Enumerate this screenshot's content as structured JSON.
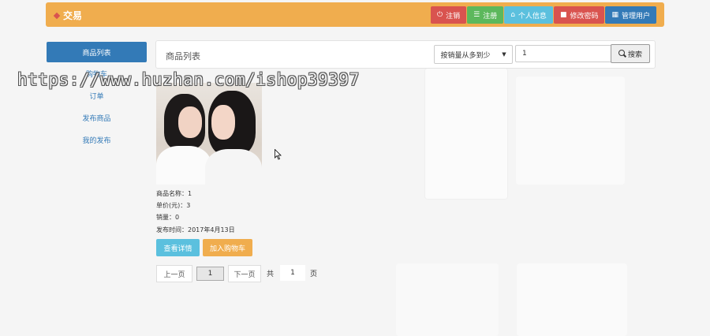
{
  "navbar": {
    "brand": "交易",
    "buttons": [
      {
        "label": "注销",
        "icon": "power-icon",
        "color": "#d9534f"
      },
      {
        "label": "注册",
        "icon": "list-icon",
        "color": "#5cb85c"
      },
      {
        "label": "个人信息",
        "icon": "home-icon",
        "color": "#5bc0de"
      },
      {
        "label": "修改密码",
        "icon": "lock-icon",
        "color": "#d9534f"
      },
      {
        "label": "管理用户",
        "icon": "grid-icon",
        "color": "#337ab7"
      }
    ]
  },
  "sidebar": {
    "items": [
      {
        "label": "商品列表"
      },
      {
        "label": "购物车"
      },
      {
        "label": "订单"
      },
      {
        "label": "发布商品"
      },
      {
        "label": "我的发布"
      }
    ]
  },
  "main": {
    "title": "商品列表",
    "sort": {
      "selected": "按销量从多到少"
    },
    "search": {
      "value": "1",
      "button_label": "搜索"
    }
  },
  "product": {
    "name_label": "商品名称：",
    "name": "1",
    "price_label": "单价(元)：",
    "price": "3",
    "sales_label": "销量：",
    "sales": "0",
    "date_label": "发布时间：",
    "date": "2017年4月13日",
    "detail_button": "查看详情",
    "cart_button": "加入购物车"
  },
  "pager": {
    "prev": "上一页",
    "current": "1",
    "next": "下一页",
    "total_prefix": "共",
    "total": "1",
    "total_suffix": "页"
  },
  "watermark": "https://www.huzhan.com/ishop39397"
}
